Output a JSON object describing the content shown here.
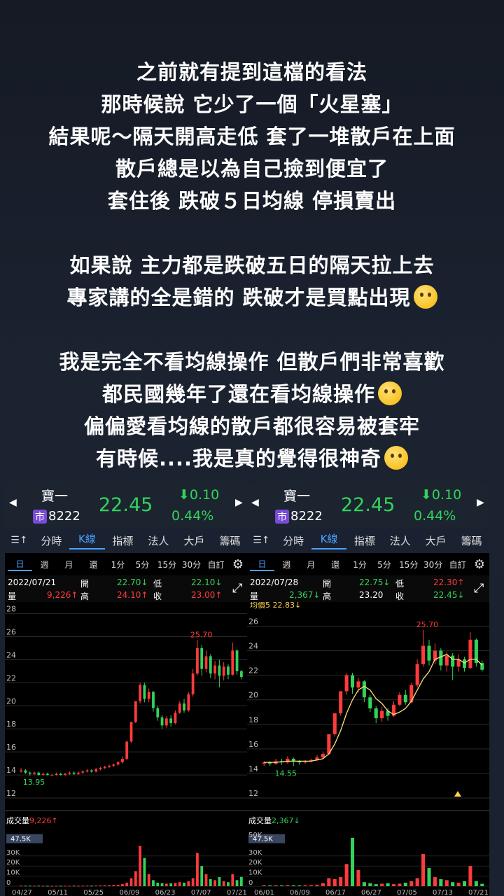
{
  "caption": {
    "lines": [
      "之前就有提到這檔的看法",
      "那時候說 它少了一個「火星塞」",
      "結果呢～隔天開高走低 套了一堆散戶在上面",
      "散戶總是以為自己撿到便宜了",
      "套住後 跌破５日均線 停損賣出",
      "",
      "如果說 主力都是跌破五日的隔天拉上去",
      "專家講的全是錯的 跌破才是買點出現",
      "",
      "我是完全不看均線操作 但散戶們非常喜歡",
      "都民國幾年了還在看均線操作",
      "偏偏愛看均線的散戶都很容易被套牢",
      "有時候....我是真的覺得很神奇"
    ],
    "emojis": {
      "7": "thinking-face-emoji",
      "10": "rofl-emoji",
      "12": "monocle-face-emoji"
    }
  },
  "panels": [
    {
      "stock_name": "寶一",
      "market_badge": "市",
      "code": "8222",
      "price": "22.45",
      "change": "⬇0.10",
      "change_pct": "0.44%",
      "tabs": [
        "分時",
        "K線",
        "指標",
        "法人",
        "大戶",
        "籌碼"
      ],
      "active_tab": 1,
      "periods": [
        "日",
        "週",
        "月",
        "還",
        "1分",
        "5分",
        "15分",
        "30分",
        "自訂"
      ],
      "active_period": 0,
      "date": "2022/07/21",
      "open_label": "開",
      "open": "22.70↓",
      "low_label": "低",
      "low": "22.10↓",
      "vol_label": "量",
      "vol": "9,226↑",
      "high_label": "高",
      "high": "24.10↑",
      "close_label": "收",
      "close": "23.00↑",
      "ma_label": "",
      "volume_title": "成交量",
      "volume_value": "9,226↑",
      "volume_max_badge": "47.5K",
      "colors": {
        "up": "#ff3b3b",
        "down": "#32d35a",
        "accent": "#4aa3ff"
      }
    },
    {
      "stock_name": "寶一",
      "market_badge": "市",
      "code": "8222",
      "price": "22.45",
      "change": "⬇0.10",
      "change_pct": "0.44%",
      "tabs": [
        "分時",
        "K線",
        "指標",
        "法人",
        "大戶",
        "籌碼"
      ],
      "active_tab": 1,
      "periods": [
        "日",
        "週",
        "月",
        "還",
        "1分",
        "5分",
        "15分",
        "30分",
        "自訂"
      ],
      "active_period": 0,
      "date": "2022/07/28",
      "open_label": "開",
      "open": "22.75↓",
      "low_label": "低",
      "low": "22.30↑",
      "vol_label": "量",
      "vol": "2,367↓",
      "high_label": "高",
      "high": "23.20",
      "close_label": "收",
      "close": "22.45↓",
      "ma_label": "均價5 22.83↓",
      "volume_title": "成交量",
      "volume_value": "2,367↓",
      "volume_max_badge": "47.5K",
      "colors": {
        "up": "#ff3b3b",
        "down": "#32d35a",
        "accent": "#4aa3ff",
        "ma": "#ffe27a"
      }
    }
  ],
  "chart_data": [
    {
      "type": "candlestick",
      "title": "寶一 8222 日K",
      "y_ticks": [
        28,
        26,
        24,
        22,
        20,
        18,
        16,
        14,
        12
      ],
      "ylim": [
        12,
        28.4
      ],
      "x_ticks": [
        "04/27",
        "05/11",
        "05/25",
        "06/09",
        "06/23",
        "07/07",
        "07/21"
      ],
      "annotations": [
        {
          "text": "25.70",
          "value": 25.7
        },
        {
          "text": "13.95",
          "value": 13.95
        }
      ],
      "candles": [
        {
          "o": 14.3,
          "c": 14.4,
          "h": 14.6,
          "l": 14.2
        },
        {
          "o": 14.4,
          "c": 14.2,
          "h": 14.5,
          "l": 14.1
        },
        {
          "o": 14.2,
          "c": 14.1,
          "h": 14.3,
          "l": 13.95
        },
        {
          "o": 14.1,
          "c": 14.2,
          "h": 14.3,
          "l": 14.0
        },
        {
          "o": 14.2,
          "c": 14.0,
          "h": 14.3,
          "l": 13.95
        },
        {
          "o": 14.0,
          "c": 14.1,
          "h": 14.2,
          "l": 13.95
        },
        {
          "o": 14.1,
          "c": 14.0,
          "h": 14.2,
          "l": 13.95
        },
        {
          "o": 14.0,
          "c": 14.0,
          "h": 14.1,
          "l": 13.95
        },
        {
          "o": 14.0,
          "c": 14.1,
          "h": 14.2,
          "l": 13.95
        },
        {
          "o": 14.1,
          "c": 14.0,
          "h": 14.2,
          "l": 13.95
        },
        {
          "o": 14.0,
          "c": 14.1,
          "h": 14.2,
          "l": 13.95
        },
        {
          "o": 14.1,
          "c": 14.2,
          "h": 14.3,
          "l": 14.0
        },
        {
          "o": 14.2,
          "c": 14.1,
          "h": 14.3,
          "l": 14.0
        },
        {
          "o": 14.1,
          "c": 14.2,
          "h": 14.3,
          "l": 14.0
        },
        {
          "o": 14.2,
          "c": 14.3,
          "h": 14.4,
          "l": 14.1
        },
        {
          "o": 14.3,
          "c": 14.4,
          "h": 14.5,
          "l": 14.2
        },
        {
          "o": 14.4,
          "c": 14.3,
          "h": 14.5,
          "l": 14.2
        },
        {
          "o": 14.3,
          "c": 14.5,
          "h": 14.6,
          "l": 14.2
        },
        {
          "o": 14.5,
          "c": 14.6,
          "h": 14.7,
          "l": 14.4
        },
        {
          "o": 14.6,
          "c": 14.7,
          "h": 14.8,
          "l": 14.5
        },
        {
          "o": 14.7,
          "c": 14.8,
          "h": 14.9,
          "l": 14.6
        },
        {
          "o": 14.8,
          "c": 14.9,
          "h": 15.0,
          "l": 14.7
        },
        {
          "o": 14.9,
          "c": 15.1,
          "h": 15.2,
          "l": 14.8
        },
        {
          "o": 15.1,
          "c": 15.4,
          "h": 15.6,
          "l": 15.0
        },
        {
          "o": 15.4,
          "c": 16.9,
          "h": 16.9,
          "l": 15.3
        },
        {
          "o": 16.9,
          "c": 18.6,
          "h": 18.6,
          "l": 16.8
        },
        {
          "o": 18.6,
          "c": 20.4,
          "h": 20.4,
          "l": 18.5
        },
        {
          "o": 20.4,
          "c": 21.8,
          "h": 22.0,
          "l": 20.2
        },
        {
          "o": 21.8,
          "c": 20.6,
          "h": 22.0,
          "l": 20.3
        },
        {
          "o": 20.6,
          "c": 21.2,
          "h": 21.5,
          "l": 20.3
        },
        {
          "o": 21.2,
          "c": 19.8,
          "h": 21.3,
          "l": 19.5
        },
        {
          "o": 19.8,
          "c": 19.0,
          "h": 20.0,
          "l": 18.7
        },
        {
          "o": 19.0,
          "c": 18.3,
          "h": 19.2,
          "l": 18.0
        },
        {
          "o": 18.3,
          "c": 18.9,
          "h": 19.1,
          "l": 18.1
        },
        {
          "o": 18.9,
          "c": 18.5,
          "h": 19.2,
          "l": 18.2
        },
        {
          "o": 18.5,
          "c": 19.4,
          "h": 19.6,
          "l": 18.4
        },
        {
          "o": 19.4,
          "c": 20.2,
          "h": 20.4,
          "l": 19.3
        },
        {
          "o": 20.2,
          "c": 19.6,
          "h": 20.6,
          "l": 19.4
        },
        {
          "o": 19.6,
          "c": 21.0,
          "h": 21.2,
          "l": 19.5
        },
        {
          "o": 21.0,
          "c": 22.8,
          "h": 23.2,
          "l": 20.8
        },
        {
          "o": 22.8,
          "c": 25.0,
          "h": 25.7,
          "l": 22.6
        },
        {
          "o": 25.0,
          "c": 23.2,
          "h": 25.3,
          "l": 22.6
        },
        {
          "o": 23.2,
          "c": 24.3,
          "h": 24.8,
          "l": 22.9
        },
        {
          "o": 24.3,
          "c": 22.8,
          "h": 24.5,
          "l": 22.4
        },
        {
          "o": 22.8,
          "c": 23.5,
          "h": 23.9,
          "l": 22.3
        },
        {
          "o": 23.5,
          "c": 22.6,
          "h": 24.0,
          "l": 21.6
        },
        {
          "o": 22.6,
          "c": 23.4,
          "h": 23.8,
          "l": 22.2
        },
        {
          "o": 23.4,
          "c": 22.7,
          "h": 23.6,
          "l": 22.3
        },
        {
          "o": 22.7,
          "c": 24.8,
          "h": 25.5,
          "l": 22.6
        },
        {
          "o": 24.8,
          "c": 23.0,
          "h": 24.9,
          "l": 22.7
        },
        {
          "o": 23.0,
          "c": 22.5,
          "h": 23.1,
          "l": 22.3
        }
      ],
      "volume": {
        "title": "成交量 9,226↑",
        "y_ticks": [
          "47.5K",
          "30K",
          "20K",
          "10K",
          "0"
        ],
        "values": [
          0.6,
          0.5,
          0.5,
          0.4,
          0.5,
          0.4,
          0.4,
          0.3,
          0.4,
          0.4,
          0.4,
          0.4,
          0.5,
          0.4,
          0.5,
          0.6,
          0.5,
          0.7,
          0.8,
          0.9,
          1.0,
          1.2,
          1.4,
          2.0,
          3.5,
          8.0,
          15.0,
          40.0,
          28.0,
          12.0,
          6.0,
          3.5,
          3.0,
          2.5,
          2.8,
          3.2,
          4.0,
          3.5,
          5.0,
          8.0,
          33.0,
          20.0,
          12.0,
          7.0,
          6.0,
          9.0,
          5.0,
          4.0,
          12.0,
          6.0,
          9.2
        ]
      }
    },
    {
      "type": "candlestick",
      "title": "寶一 8222 日K",
      "y_ticks": [
        26,
        24,
        22,
        20,
        18,
        16,
        14,
        12
      ],
      "ylim": [
        12,
        27.4
      ],
      "x_ticks": [
        "06/01",
        "06/09",
        "06/17",
        "06/27",
        "07/05",
        "07/13",
        "07/21"
      ],
      "annotations": [
        {
          "text": "25.70",
          "value": 25.7
        },
        {
          "text": "14.55",
          "value": 14.55
        }
      ],
      "ma5_label": "均價5 22.83↓",
      "candles": [
        {
          "o": 14.8,
          "c": 14.9,
          "h": 15.0,
          "l": 14.6
        },
        {
          "o": 14.9,
          "c": 14.8,
          "h": 15.0,
          "l": 14.6
        },
        {
          "o": 14.8,
          "c": 15.0,
          "h": 15.2,
          "l": 14.7
        },
        {
          "o": 15.0,
          "c": 14.9,
          "h": 15.2,
          "l": 14.7
        },
        {
          "o": 14.9,
          "c": 15.2,
          "h": 15.4,
          "l": 14.8
        },
        {
          "o": 15.2,
          "c": 15.0,
          "h": 15.3,
          "l": 14.6
        },
        {
          "o": 15.0,
          "c": 14.9,
          "h": 15.1,
          "l": 14.7
        },
        {
          "o": 14.9,
          "c": 15.0,
          "h": 15.1,
          "l": 14.8
        },
        {
          "o": 15.0,
          "c": 15.1,
          "h": 15.2,
          "l": 14.9
        },
        {
          "o": 15.1,
          "c": 15.3,
          "h": 15.5,
          "l": 15.0
        },
        {
          "o": 15.3,
          "c": 15.6,
          "h": 15.8,
          "l": 15.2
        },
        {
          "o": 15.6,
          "c": 17.2,
          "h": 17.2,
          "l": 15.5
        },
        {
          "o": 17.2,
          "c": 18.9,
          "h": 18.9,
          "l": 17.0
        },
        {
          "o": 18.9,
          "c": 20.7,
          "h": 20.7,
          "l": 18.7
        },
        {
          "o": 20.7,
          "c": 22.0,
          "h": 22.2,
          "l": 20.4
        },
        {
          "o": 22.0,
          "c": 21.0,
          "h": 22.2,
          "l": 20.5
        },
        {
          "o": 21.0,
          "c": 21.5,
          "h": 21.8,
          "l": 20.6
        },
        {
          "o": 21.5,
          "c": 20.2,
          "h": 21.6,
          "l": 19.8
        },
        {
          "o": 20.2,
          "c": 19.3,
          "h": 20.4,
          "l": 19.0
        },
        {
          "o": 19.3,
          "c": 18.5,
          "h": 19.5,
          "l": 18.1
        },
        {
          "o": 18.5,
          "c": 19.1,
          "h": 19.4,
          "l": 18.2
        },
        {
          "o": 19.1,
          "c": 18.7,
          "h": 19.3,
          "l": 18.3
        },
        {
          "o": 18.7,
          "c": 19.6,
          "h": 19.9,
          "l": 18.6
        },
        {
          "o": 19.6,
          "c": 20.4,
          "h": 20.6,
          "l": 19.5
        },
        {
          "o": 20.4,
          "c": 19.8,
          "h": 20.8,
          "l": 19.6
        },
        {
          "o": 19.8,
          "c": 21.2,
          "h": 21.4,
          "l": 19.7
        },
        {
          "o": 21.2,
          "c": 22.9,
          "h": 23.3,
          "l": 21.0
        },
        {
          "o": 22.9,
          "c": 24.4,
          "h": 25.7,
          "l": 22.7
        },
        {
          "o": 24.4,
          "c": 23.2,
          "h": 24.9,
          "l": 22.8
        },
        {
          "o": 23.2,
          "c": 24.0,
          "h": 24.6,
          "l": 22.9
        },
        {
          "o": 24.0,
          "c": 22.8,
          "h": 24.2,
          "l": 22.4
        },
        {
          "o": 22.8,
          "c": 23.6,
          "h": 23.9,
          "l": 22.3
        },
        {
          "o": 23.6,
          "c": 22.7,
          "h": 23.8,
          "l": 21.6
        },
        {
          "o": 22.7,
          "c": 23.3,
          "h": 23.7,
          "l": 22.3
        },
        {
          "o": 23.3,
          "c": 22.6,
          "h": 23.5,
          "l": 22.3
        },
        {
          "o": 22.6,
          "c": 24.9,
          "h": 25.5,
          "l": 22.5
        },
        {
          "o": 24.9,
          "c": 23.0,
          "h": 25.0,
          "l": 22.7
        },
        {
          "o": 23.0,
          "c": 22.45,
          "h": 23.2,
          "l": 22.3
        }
      ],
      "ma5": [
        14.9,
        14.9,
        14.9,
        14.95,
        15.0,
        15.0,
        15.0,
        15.0,
        15.0,
        15.1,
        15.2,
        15.6,
        16.4,
        17.5,
        18.9,
        20.0,
        20.8,
        21.1,
        20.8,
        20.1,
        19.7,
        19.1,
        18.8,
        19.0,
        19.3,
        19.9,
        20.8,
        21.7,
        22.3,
        23.3,
        23.5,
        23.7,
        23.3,
        23.3,
        23.0,
        23.3,
        23.3,
        22.83
      ],
      "volume": {
        "title": "成交量 2,367↓",
        "y_ticks": [
          "47.5K",
          "30K",
          "20K",
          "10K",
          "0"
        ],
        "values": [
          1.0,
          0.8,
          0.9,
          0.8,
          1.0,
          0.9,
          0.8,
          0.9,
          1.0,
          1.5,
          3.0,
          8.0,
          7.0,
          9.0,
          22.0,
          48.0,
          16.0,
          4.0,
          3.0,
          2.0,
          2.5,
          3.0,
          2.0,
          2.5,
          3.5,
          5.0,
          8.0,
          32.0,
          18.0,
          9.0,
          7.0,
          6.0,
          4.0,
          3.5,
          5.0,
          20.0,
          5.0,
          2.4
        ]
      }
    }
  ]
}
